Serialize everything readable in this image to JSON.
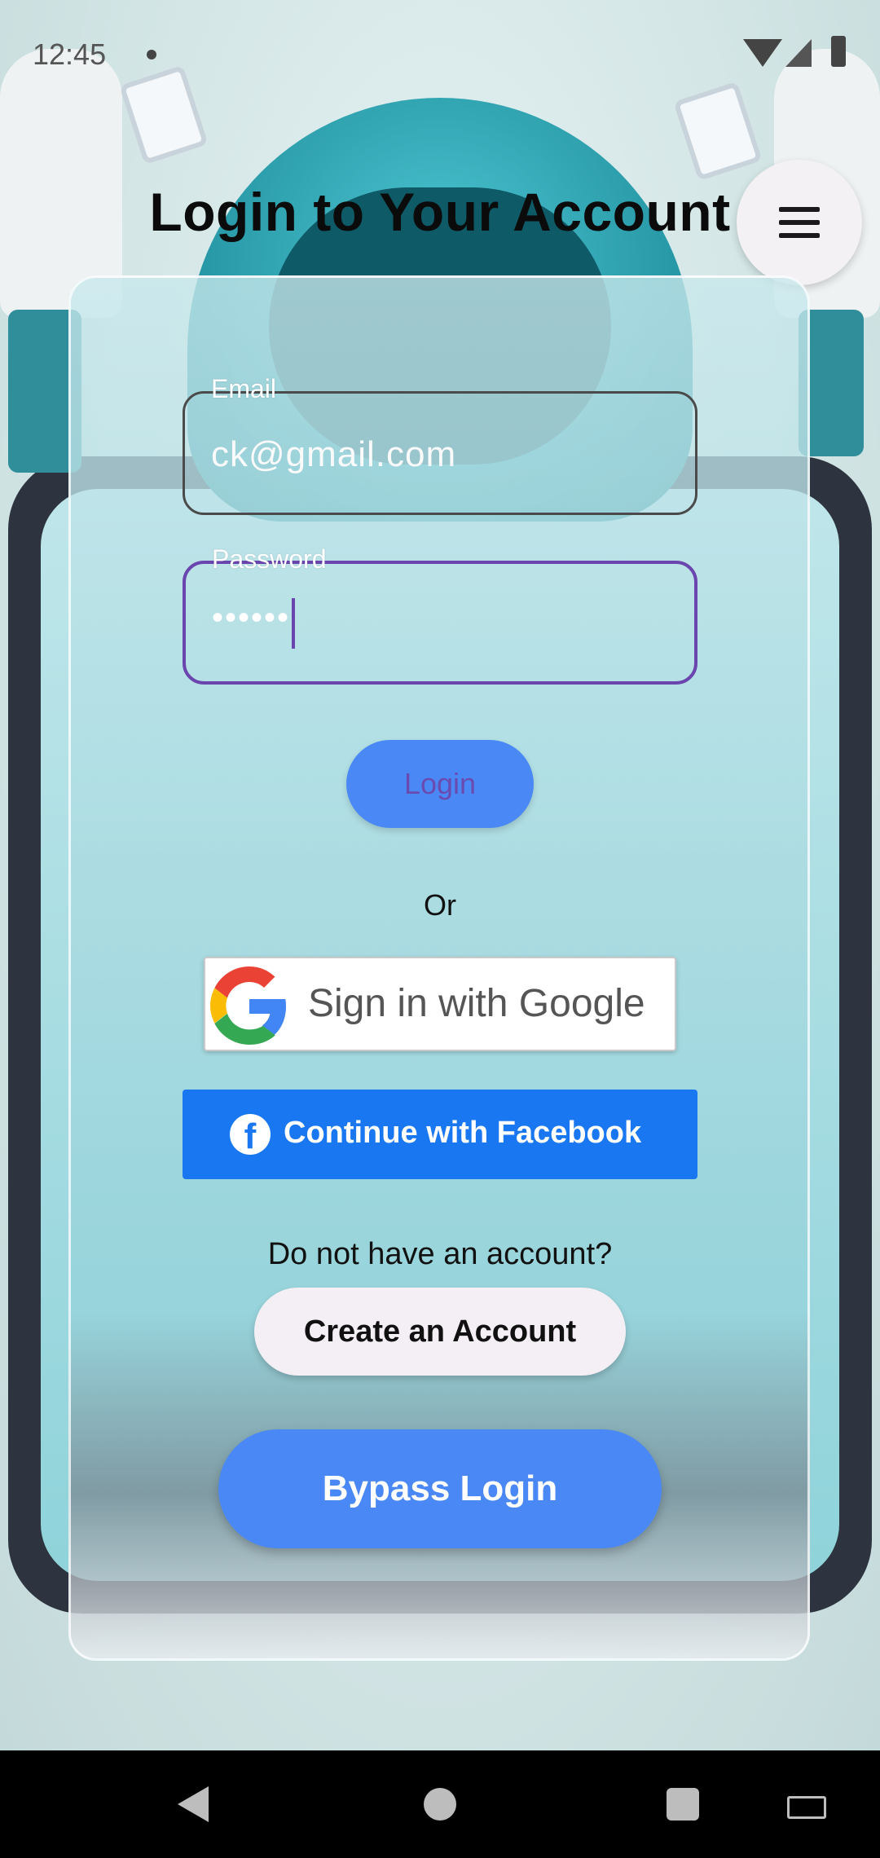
{
  "status_bar": {
    "time": "12:45"
  },
  "header": {
    "title": "Login to Your Account",
    "menu_icon": "hamburger-menu-icon"
  },
  "form": {
    "email": {
      "label": "Email",
      "value": "ck@gmail.com"
    },
    "password": {
      "label": "Password",
      "masked_value": "••••••"
    },
    "login_label": "Login",
    "or_label": "Or",
    "google_label": "Sign in with Google",
    "facebook_label": "Continue with Facebook",
    "no_account_text": "Do not have an account?",
    "create_account_label": "Create an Account",
    "bypass_label": "Bypass Login"
  },
  "colors": {
    "primary_button": "#4a88f5",
    "facebook": "#1977f2",
    "focus_border": "#6a45ae"
  }
}
